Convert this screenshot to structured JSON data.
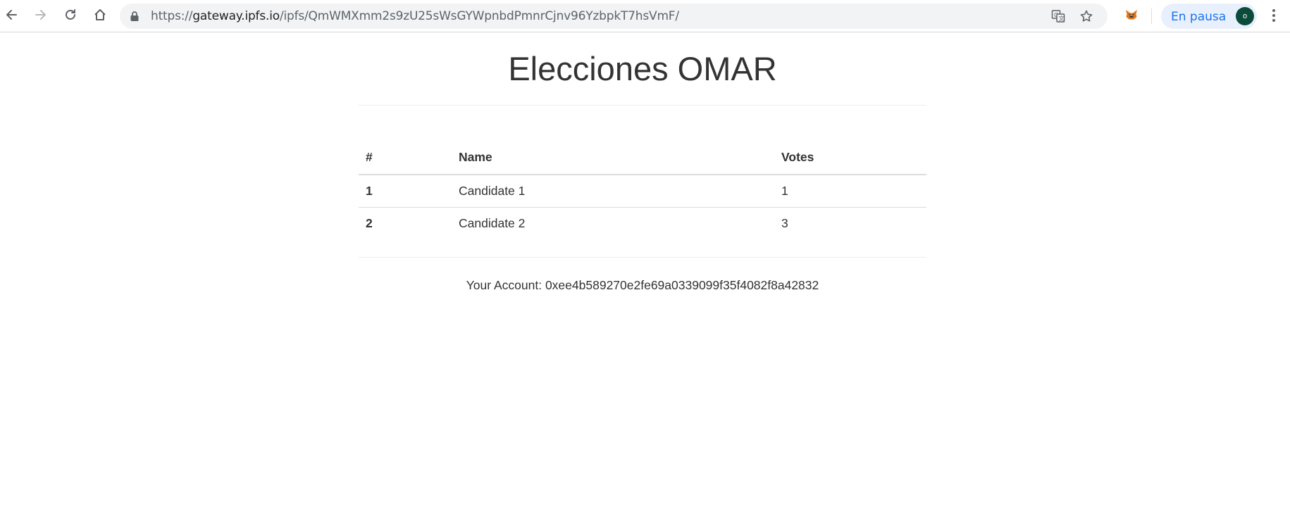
{
  "browser": {
    "url": {
      "scheme": "https://",
      "host": "gateway.ipfs.io",
      "path": "/ipfs/QmWMXmm2s9zU25sWsGYWpnbdPmnrCjnv96YzbpkT7hsVmF/"
    },
    "profile_status": "En pausa",
    "avatar_initial": "o",
    "icons": {
      "back": "back-arrow-icon",
      "forward": "forward-arrow-icon",
      "reload": "reload-icon",
      "home": "home-icon",
      "lock": "lock-icon",
      "translate": "translate-icon",
      "bookmark": "star-icon",
      "extension": "metamask-fox-icon",
      "menu": "kebab-menu-icon"
    },
    "colors": {
      "omnibox_bg": "#f1f3f4",
      "chip_bg": "#e8f0fe",
      "chip_text": "#1a73e8",
      "avatar_bg": "#0b4b3a"
    }
  },
  "page": {
    "title": "Elecciones OMAR",
    "table": {
      "headers": [
        "#",
        "Name",
        "Votes"
      ],
      "rows": [
        {
          "id": "1",
          "name": "Candidate 1",
          "votes": "1"
        },
        {
          "id": "2",
          "name": "Candidate 2",
          "votes": "3"
        }
      ]
    },
    "account_label": "Your Account:",
    "account_address": "0xee4b589270e2fe69a0339099f35f4082f8a42832"
  }
}
